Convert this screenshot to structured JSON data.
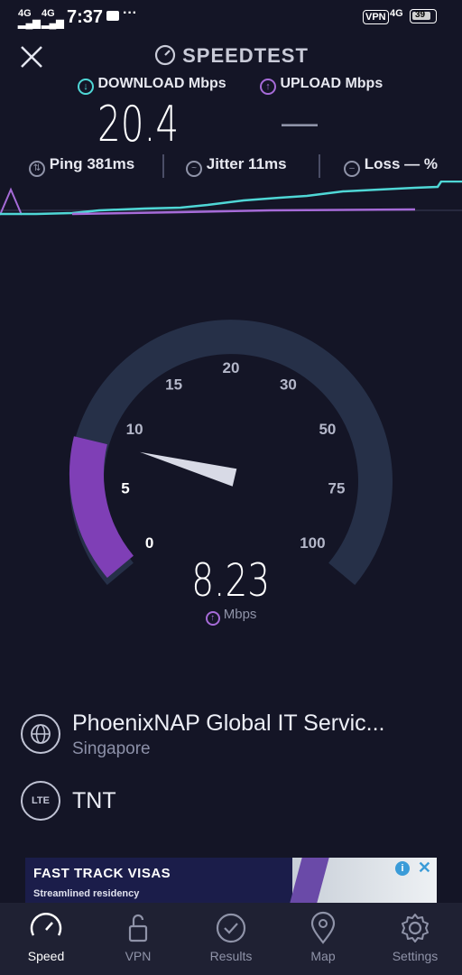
{
  "status_bar": {
    "signal1": "4G",
    "signal2": "4G",
    "time": "7:37",
    "vpn": "VPN",
    "net": "4G",
    "battery": "39"
  },
  "header": {
    "title": "SPEEDTEST",
    "download_label": "DOWNLOAD Mbps",
    "upload_label": "UPLOAD Mbps",
    "download_value": "20.4",
    "upload_value": "—"
  },
  "metrics": {
    "ping_label": "Ping",
    "ping_value": "381ms",
    "jitter_label": "Jitter",
    "jitter_value": "11ms",
    "loss_label": "Loss",
    "loss_value": "—",
    "loss_unit": "%"
  },
  "gauge": {
    "ticks": [
      "0",
      "5",
      "10",
      "15",
      "20",
      "30",
      "50",
      "75",
      "100"
    ],
    "value": "8.23",
    "unit": "Mbps"
  },
  "server": {
    "name": "PhoenixNAP Global IT Servic...",
    "location": "Singapore",
    "isp_badge": "LTE",
    "isp": "TNT"
  },
  "ad": {
    "headline": "FAST TRACK VISAS",
    "subline": "Streamlined residency"
  },
  "nav": {
    "items": [
      {
        "label": "Speed"
      },
      {
        "label": "VPN"
      },
      {
        "label": "Results"
      },
      {
        "label": "Map"
      },
      {
        "label": "Settings"
      }
    ]
  },
  "colors": {
    "background": "#141526",
    "download_accent": "#4fd7d6",
    "upload_accent": "#a66bd8",
    "gauge_track": "#263048"
  }
}
